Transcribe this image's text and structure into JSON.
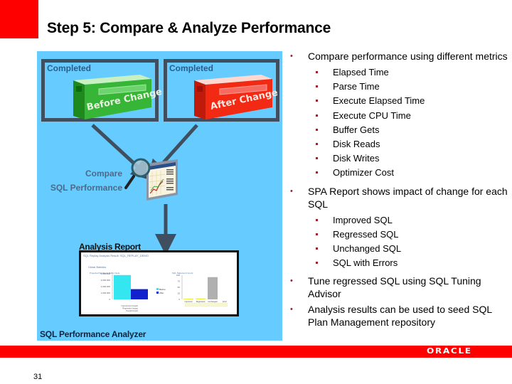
{
  "slide": {
    "title": "Step 5: Compare & Analyze Performance",
    "page_number": "31",
    "brand": "ORACLE",
    "accent_color": "#ff0000",
    "panel_color": "#66ccff",
    "bullet_color": "#a02030"
  },
  "diagram": {
    "before_stage": {
      "status": "Completed",
      "book_label": "Before Change",
      "book_color": "#2ea82e"
    },
    "after_stage": {
      "status": "Completed",
      "book_label": "After Change",
      "book_color": "#ee2211"
    },
    "compare_label_line1": "Compare",
    "compare_label_line2": "SQL Performance",
    "compare_icon": "magnifier-report-icon",
    "report_title": "Analysis Report",
    "report": {
      "header": "SQL Replay Analysis Result: SQL_REPLAY_DEMO",
      "left_chart": {
        "title": "Projected Workload Buffer Gets",
        "ticks": [
          "4,000,000",
          "3,000,000",
          "2,000,000",
          "1,000,000",
          "0"
        ],
        "legend": [
          "Before",
          "After"
        ],
        "values": [
          3800000,
          1600000
        ],
        "colors": [
          "#33e6f0",
          "#1122cc"
        ]
      },
      "right_chart": {
        "title": "SQL Statement Count",
        "ticks": [
          "100",
          "75",
          "50",
          "25",
          "0"
        ],
        "categories": [
          "Improved",
          "Regressed",
          "Unchanged",
          "Error"
        ],
        "values": [
          3,
          4,
          92,
          0
        ]
      }
    },
    "footer_label": "SQL Performance Analyzer"
  },
  "bullets": [
    {
      "text": "Compare performance using different metrics",
      "sub": [
        "Elapsed Time",
        "Parse Time",
        "Execute Elapsed Time",
        "Execute CPU Time",
        "Buffer Gets",
        "Disk Reads",
        "Disk Writes",
        "Optimizer Cost"
      ]
    },
    {
      "text": "SPA Report shows impact of change for each SQL",
      "sub": [
        "Improved SQL",
        "Regressed SQL",
        "Unchanged SQL",
        "SQL with Errors"
      ]
    },
    {
      "text": "Tune regressed SQL using SQL Tuning Advisor",
      "sub": []
    },
    {
      "text": "Analysis results can be used to seed SQL Plan Management repository",
      "sub": []
    }
  ]
}
